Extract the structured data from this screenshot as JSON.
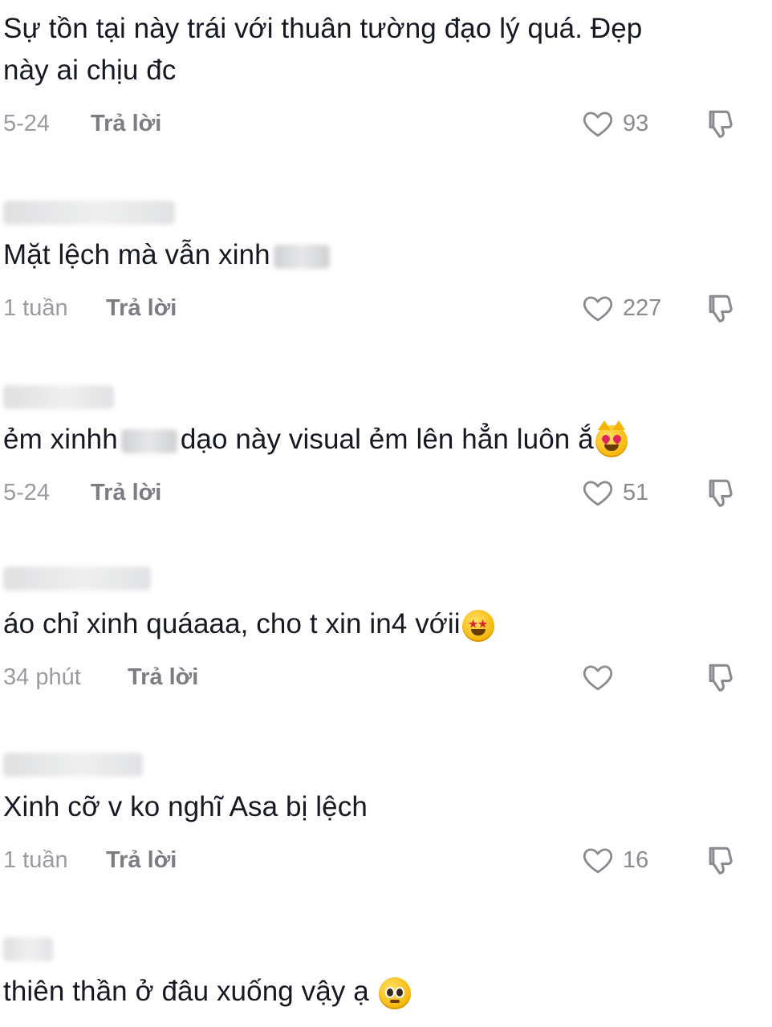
{
  "reply_label": "Trả lời",
  "comments": [
    {
      "text_line1": "Sự tồn tại này trái với thuân tường đạo lý quá. Đẹp",
      "text_line2": "này ai chịu đc",
      "time": "5-24",
      "likes": "93"
    },
    {
      "text": "Mặt lệch mà vẫn xinh",
      "time": "1 tuần",
      "likes": "227"
    },
    {
      "text_before": "ẻm xinhh",
      "text_after": "dạo này visual ẻm lên hẳn luôn ắ",
      "emoji": "heart-eyes-cat-emoji",
      "time": "5-24",
      "likes": "51"
    },
    {
      "text": "áo chỉ xinh quáaaa, cho t xin in4 vớii",
      "emoji": "star-struck-emoji",
      "time": "34 phút",
      "likes": ""
    },
    {
      "text": "Xinh cỡ v ko nghĩ Asa bị lệch",
      "time": "1 tuần",
      "likes": "16"
    },
    {
      "text": "thiên thần ở đâu xuống vậy ạ",
      "emoji": "pleading-face-emoji"
    }
  ],
  "colors": {
    "text": "#161823",
    "meta": "#9a9ba1",
    "icon": "#8a8b91"
  }
}
